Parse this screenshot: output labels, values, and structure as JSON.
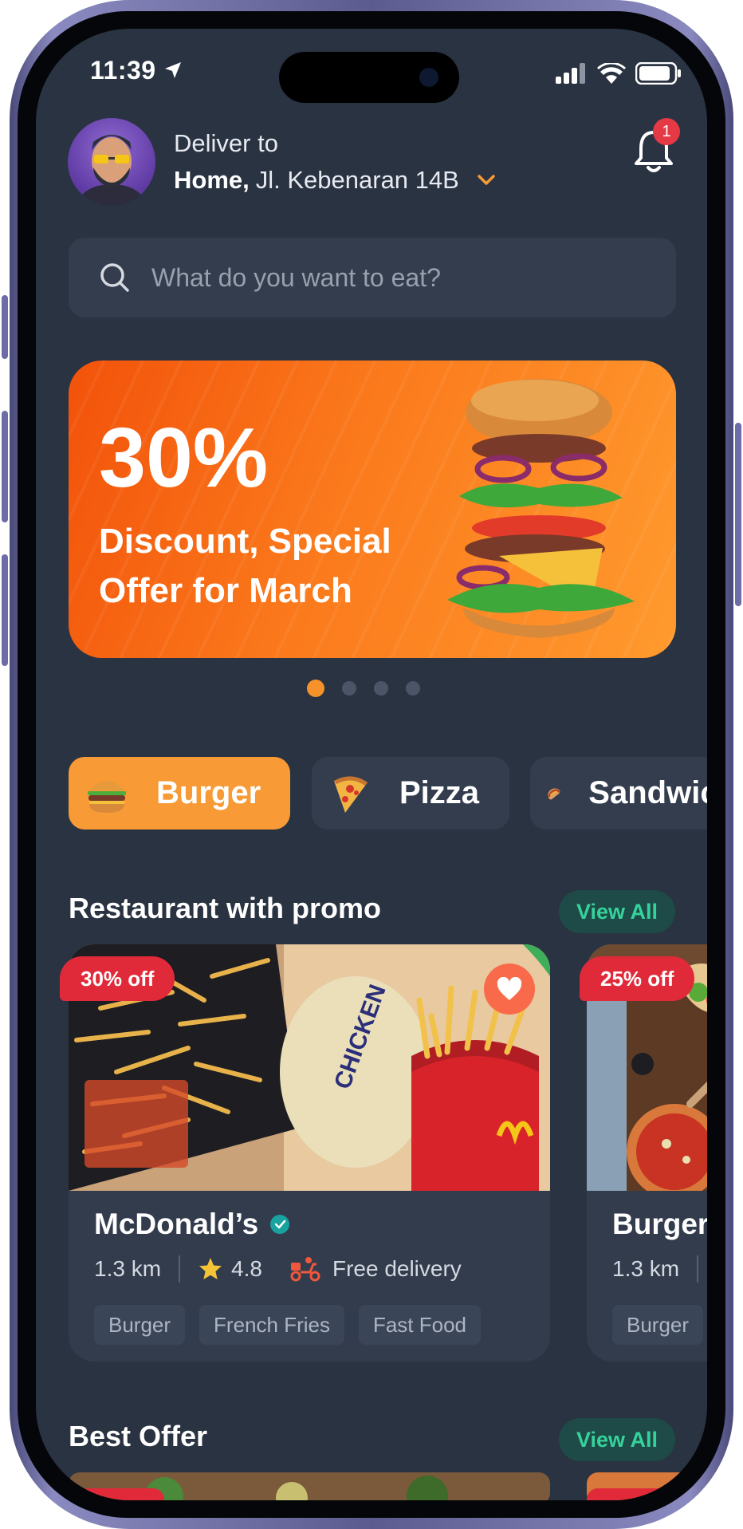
{
  "status_bar": {
    "time": "11:39"
  },
  "header": {
    "deliver_label": "Deliver to",
    "address_bold": "Home,",
    "address_rest": "Jl. Kebenaran 14B",
    "notification_count": "1"
  },
  "search": {
    "placeholder": "What do you want to eat?"
  },
  "banner": {
    "percent": "30%",
    "text": "Discount, Special Offer for March",
    "pagination": {
      "total": 4,
      "active": 1
    }
  },
  "categories": [
    {
      "label": "Burger",
      "icon": "burger-icon",
      "active": true
    },
    {
      "label": "Pizza",
      "icon": "pizza-icon",
      "active": false
    },
    {
      "label": "Sandwich",
      "icon": "hotdog-icon",
      "active": false
    }
  ],
  "promo_section": {
    "title": "Restaurant with promo",
    "view_all": "View All",
    "cards": [
      {
        "discount": "30% off",
        "name": "McDonald’s",
        "verified": true,
        "distance": "1.3 km",
        "rating": "4.8",
        "delivery": "Free delivery",
        "tags": [
          "Burger",
          "French Fries",
          "Fast Food"
        ]
      },
      {
        "discount": "25% off",
        "name": "Burger",
        "distance": "1.3 km",
        "tags": [
          "Burger"
        ]
      }
    ]
  },
  "best_offer_section": {
    "title": "Best Offer",
    "view_all": "View All"
  },
  "colors": {
    "background": "#2a3342",
    "surface": "#333d4e",
    "accent_orange": "#f89a35",
    "discount_red": "#e02a3a",
    "view_all_text": "#35d29a",
    "view_all_bg": "#1e4a48"
  }
}
